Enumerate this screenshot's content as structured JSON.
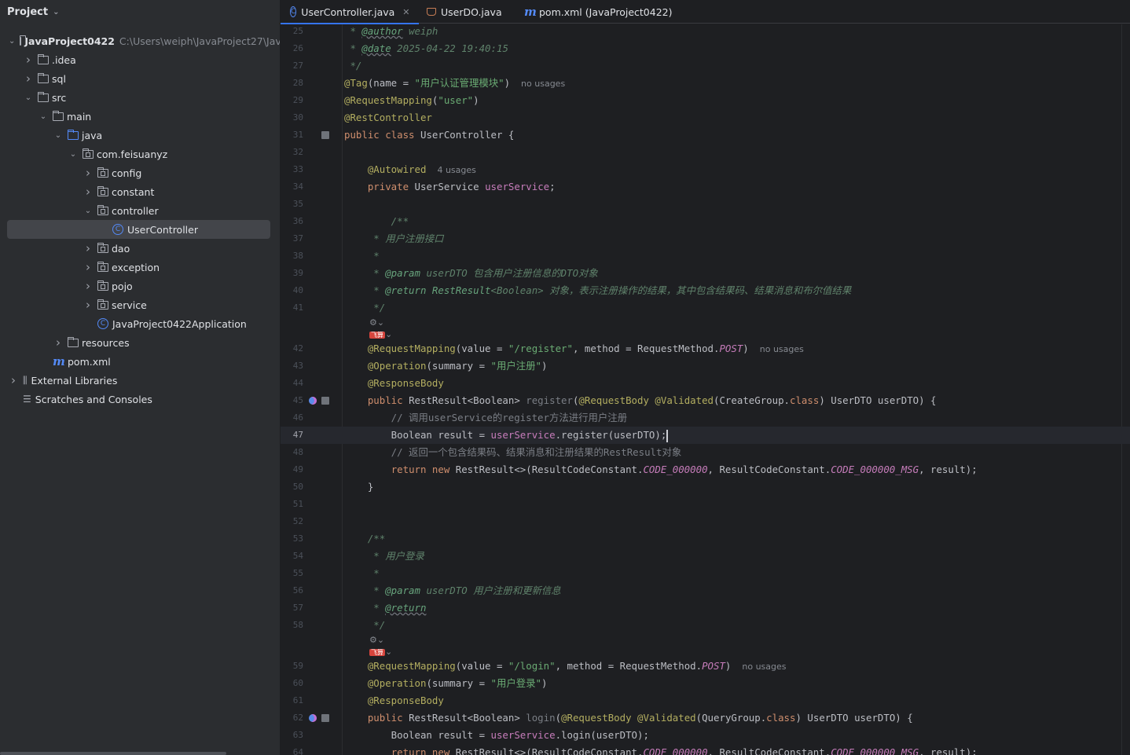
{
  "sidebar": {
    "title": "Project",
    "tree": [
      {
        "label": "JavaProject0422",
        "hint": "C:\\Users\\weiph\\JavaProject27\\JavaProject0422",
        "icon": "folder-icon",
        "indent": 0,
        "arrow": "down",
        "bold": true
      },
      {
        "label": ".idea",
        "icon": "folder-icon",
        "indent": 1,
        "arrow": "right"
      },
      {
        "label": "sql",
        "icon": "folder-icon",
        "indent": 1,
        "arrow": "right"
      },
      {
        "label": "src",
        "icon": "folder-icon",
        "indent": 1,
        "arrow": "down"
      },
      {
        "label": "main",
        "icon": "folder-icon",
        "indent": 2,
        "arrow": "down"
      },
      {
        "label": "java",
        "icon": "source-folder-icon",
        "indent": 3,
        "arrow": "down"
      },
      {
        "label": "com.feisuanyz",
        "icon": "package-icon",
        "indent": 4,
        "arrow": "down"
      },
      {
        "label": "config",
        "icon": "package-icon",
        "indent": 5,
        "arrow": "right"
      },
      {
        "label": "constant",
        "icon": "package-icon",
        "indent": 5,
        "arrow": "right"
      },
      {
        "label": "controller",
        "icon": "package-icon",
        "indent": 5,
        "arrow": "down"
      },
      {
        "label": "UserController",
        "icon": "class-icon",
        "indent": 6,
        "arrow": "none",
        "selected": true
      },
      {
        "label": "dao",
        "icon": "package-icon",
        "indent": 5,
        "arrow": "right"
      },
      {
        "label": "exception",
        "icon": "package-icon",
        "indent": 5,
        "arrow": "right"
      },
      {
        "label": "pojo",
        "icon": "package-icon",
        "indent": 5,
        "arrow": "right"
      },
      {
        "label": "service",
        "icon": "package-icon",
        "indent": 5,
        "arrow": "right"
      },
      {
        "label": "JavaProject0422Application",
        "icon": "spring-boot-class-icon",
        "indent": 5,
        "arrow": "none"
      },
      {
        "label": "resources",
        "icon": "resources-folder-icon",
        "indent": 3,
        "arrow": "right"
      },
      {
        "label": "pom.xml",
        "icon": "maven-icon",
        "indent": 2,
        "arrow": "none"
      },
      {
        "label": "External Libraries",
        "icon": "library-icon",
        "indent": 0,
        "arrow": "right"
      },
      {
        "label": "Scratches and Consoles",
        "icon": "scratches-icon",
        "indent": 0,
        "arrow": "none"
      }
    ]
  },
  "tabs": [
    {
      "label": "UserController.java",
      "icon": "class-icon",
      "active": true,
      "closable": true
    },
    {
      "label": "UserDO.java",
      "icon": "record-icon",
      "active": false
    },
    {
      "label": "pom.xml (JavaProject0422)",
      "icon": "maven-icon",
      "active": false
    }
  ],
  "editor": {
    "current_line": "47",
    "lines": [
      {
        "n": "25",
        "tokens": [
          [
            " * ",
            "dc"
          ],
          [
            "@author",
            "dt u"
          ],
          [
            " weiph",
            "dc"
          ]
        ]
      },
      {
        "n": "26",
        "tokens": [
          [
            " * ",
            "dc"
          ],
          [
            "@date",
            "dt u"
          ],
          [
            " 2025-04-22 19:40:15",
            "dc"
          ]
        ]
      },
      {
        "n": "27",
        "tokens": [
          [
            " */",
            "dc"
          ]
        ]
      },
      {
        "n": "28",
        "tokens": [
          [
            "@Tag",
            "an"
          ],
          [
            "(name = ",
            ""
          ],
          [
            "\"用户认证管理模块\"",
            "s"
          ],
          [
            ")",
            ""
          ],
          [
            "no usages",
            "usage"
          ]
        ]
      },
      {
        "n": "29",
        "tokens": [
          [
            "@RequestMapping",
            "an"
          ],
          [
            "(",
            ""
          ],
          [
            "\"user\"",
            "s"
          ],
          [
            ")",
            ""
          ]
        ]
      },
      {
        "n": "30",
        "tokens": [
          [
            "@RestController",
            "an"
          ]
        ]
      },
      {
        "n": "31",
        "bookmark": true,
        "tokens": [
          [
            "public class ",
            "k"
          ],
          [
            "UserController",
            ""
          ],
          [
            " {",
            ""
          ]
        ]
      },
      {
        "n": "32",
        "tokens": []
      },
      {
        "n": "33",
        "tokens": [
          [
            "    ",
            ""
          ],
          [
            "@Autowired",
            "an"
          ],
          [
            "4 usages",
            "usage"
          ]
        ]
      },
      {
        "n": "34",
        "tokens": [
          [
            "    ",
            ""
          ],
          [
            "private ",
            "k"
          ],
          [
            "UserService ",
            ""
          ],
          [
            "userService",
            "f"
          ],
          [
            ";",
            ""
          ]
        ]
      },
      {
        "n": "35",
        "tokens": []
      },
      {
        "n": "36",
        "tokens": [
          [
            "        /**",
            "dc"
          ]
        ]
      },
      {
        "n": "37",
        "tokens": [
          [
            "     * 用户注册接口",
            "dc"
          ]
        ]
      },
      {
        "n": "38",
        "tokens": [
          [
            "     *",
            "dc"
          ]
        ]
      },
      {
        "n": "39",
        "tokens": [
          [
            "     * ",
            "dc"
          ],
          [
            "@param",
            "dt"
          ],
          [
            " userDTO",
            "dc"
          ],
          [
            " 包含用户注册信息的DTO对象",
            "dc"
          ]
        ]
      },
      {
        "n": "40",
        "tokens": [
          [
            "     * ",
            "dc"
          ],
          [
            "@return",
            "dt"
          ],
          [
            " RestResult",
            "dt"
          ],
          [
            "<Boolean>",
            "dc"
          ],
          [
            " 对象，表示注册操作的结果，其中包含结果码、结果消息和布尔值结果",
            "dc"
          ]
        ]
      },
      {
        "n": "41",
        "tokens": [
          [
            "     */",
            "dc"
          ]
        ],
        "hint_after": true
      },
      {
        "n": "42",
        "tokens": [
          [
            "    ",
            ""
          ],
          [
            "@RequestMapping",
            "an"
          ],
          [
            "(value = ",
            ""
          ],
          [
            "\"/register\"",
            "s"
          ],
          [
            ", method = RequestMethod.",
            ""
          ],
          [
            "POST",
            "cf"
          ],
          [
            ")",
            ""
          ],
          [
            "no usages",
            "usage"
          ]
        ]
      },
      {
        "n": "43",
        "tokens": [
          [
            "    ",
            ""
          ],
          [
            "@Operation",
            "an"
          ],
          [
            "(summary = ",
            ""
          ],
          [
            "\"用户注册\"",
            "s"
          ],
          [
            ")",
            ""
          ]
        ]
      },
      {
        "n": "44",
        "tokens": [
          [
            "    ",
            ""
          ],
          [
            "@ResponseBody",
            "an"
          ]
        ]
      },
      {
        "n": "45",
        "bean": true,
        "bookmark": true,
        "tokens": [
          [
            "    ",
            ""
          ],
          [
            "public ",
            "k"
          ],
          [
            "RestResult<Boolean> ",
            ""
          ],
          [
            "register",
            "cm"
          ],
          [
            "(",
            ""
          ],
          [
            "@RequestBody ",
            "an"
          ],
          [
            "@Validated",
            "an"
          ],
          [
            "(CreateGroup.",
            ""
          ],
          [
            "class",
            "k"
          ],
          [
            ") UserDTO userDTO) {",
            ""
          ]
        ]
      },
      {
        "n": "46",
        "tokens": [
          [
            "        // 调用userService的register方法进行用户注册",
            "cm"
          ]
        ]
      },
      {
        "n": "47",
        "caret": true,
        "tokens": [
          [
            "        Boolean result = ",
            ""
          ],
          [
            "userService",
            "f"
          ],
          [
            ".register(userDTO);",
            ""
          ]
        ]
      },
      {
        "n": "48",
        "tokens": [
          [
            "        // 返回一个包含结果码、结果消息和注册结果的RestResult对象",
            "cm"
          ]
        ]
      },
      {
        "n": "49",
        "tokens": [
          [
            "        ",
            ""
          ],
          [
            "return new ",
            "k"
          ],
          [
            "RestResult<>(ResultCodeConstant.",
            ""
          ],
          [
            "CODE_000000",
            "cf"
          ],
          [
            ", ResultCodeConstant.",
            ""
          ],
          [
            "CODE_000000_MSG",
            "cf"
          ],
          [
            ", result);",
            ""
          ]
        ]
      },
      {
        "n": "50",
        "tokens": [
          [
            "    }",
            ""
          ]
        ]
      },
      {
        "n": "51",
        "tokens": []
      },
      {
        "n": "52",
        "tokens": []
      },
      {
        "n": "53",
        "tokens": [
          [
            "    /**",
            "dc"
          ]
        ]
      },
      {
        "n": "54",
        "tokens": [
          [
            "     * 用户登录",
            "dc"
          ]
        ]
      },
      {
        "n": "55",
        "tokens": [
          [
            "     *",
            "dc"
          ]
        ]
      },
      {
        "n": "56",
        "tokens": [
          [
            "     * ",
            "dc"
          ],
          [
            "@param",
            "dt"
          ],
          [
            " userDTO",
            "dc"
          ],
          [
            " 用户注册和更新信息",
            "dc"
          ]
        ]
      },
      {
        "n": "57",
        "tokens": [
          [
            "     * ",
            "dc"
          ],
          [
            "@return",
            "dt u"
          ]
        ]
      },
      {
        "n": "58",
        "tokens": [
          [
            "     */",
            "dc"
          ]
        ],
        "hint_after": true
      },
      {
        "n": "59",
        "tokens": [
          [
            "    ",
            ""
          ],
          [
            "@RequestMapping",
            "an"
          ],
          [
            "(value = ",
            ""
          ],
          [
            "\"/login\"",
            "s"
          ],
          [
            ", method = RequestMethod.",
            ""
          ],
          [
            "POST",
            "cf"
          ],
          [
            ")",
            ""
          ],
          [
            "no usages",
            "usage"
          ]
        ]
      },
      {
        "n": "60",
        "tokens": [
          [
            "    ",
            ""
          ],
          [
            "@Operation",
            "an"
          ],
          [
            "(summary = ",
            ""
          ],
          [
            "\"用户登录\"",
            "s"
          ],
          [
            ")",
            ""
          ]
        ]
      },
      {
        "n": "61",
        "tokens": [
          [
            "    ",
            ""
          ],
          [
            "@ResponseBody",
            "an"
          ]
        ]
      },
      {
        "n": "62",
        "bean": true,
        "bookmark": true,
        "tokens": [
          [
            "    ",
            ""
          ],
          [
            "public ",
            "k"
          ],
          [
            "RestResult<Boolean> ",
            ""
          ],
          [
            "login",
            "cm"
          ],
          [
            "(",
            ""
          ],
          [
            "@RequestBody ",
            "an"
          ],
          [
            "@Validated",
            "an"
          ],
          [
            "(QueryGroup.",
            ""
          ],
          [
            "class",
            "k"
          ],
          [
            ") UserDTO userDTO) {",
            ""
          ]
        ]
      },
      {
        "n": "63",
        "tokens": [
          [
            "        Boolean result = ",
            ""
          ],
          [
            "userService",
            "f"
          ],
          [
            ".login(userDTO);",
            ""
          ]
        ]
      },
      {
        "n": "64",
        "tokens": [
          [
            "        ",
            ""
          ],
          [
            "return new ",
            "k"
          ],
          [
            "RestResult<>(ResultCodeConstant.",
            ""
          ],
          [
            "CODE_000000",
            "cf"
          ],
          [
            ", ResultCodeConstant.",
            ""
          ],
          [
            "CODE_000000_MSG",
            "cf"
          ],
          [
            ", result);",
            ""
          ]
        ]
      }
    ],
    "hint_badge": "飞算"
  }
}
